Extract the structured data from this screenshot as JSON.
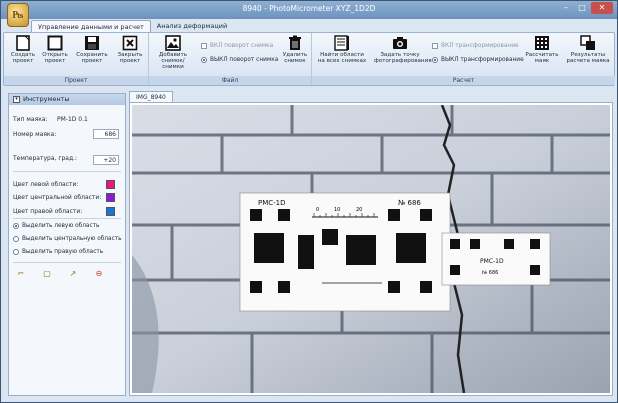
{
  "window": {
    "title": "8940 - PhotoMicrometer XYZ_1D2D",
    "logo_letter": "₧",
    "min": "–",
    "max": "□",
    "close": "✕"
  },
  "tabs": [
    {
      "label": "Управление данными и расчет",
      "active": true
    },
    {
      "label": "Анализ деформаций",
      "active": false
    }
  ],
  "ribbon": {
    "project": {
      "label": "Проект",
      "buttons": [
        {
          "label": "Создать проект",
          "icon": "new-project-icon"
        },
        {
          "label": "Открыть проект",
          "icon": "open-project-icon"
        },
        {
          "label": "Сохранить проект",
          "icon": "save-icon"
        },
        {
          "label": "Закрыть проект",
          "icon": "close-project-icon"
        }
      ]
    },
    "file": {
      "label": "Файл",
      "add_label": "Добавить снимок/снимки",
      "rot_on": "ВКЛ поворот снимка",
      "rot_off": "ВЫКЛ поворот снимка",
      "delete_label": "Удалить снимок"
    },
    "calc": {
      "label": "Расчет",
      "find_label": "Найти области на всех снимках",
      "point_label": "Задать точку фотографирования",
      "tr_on": "ВКЛ трансформирование",
      "tr_off": "ВЫКЛ трансформирование",
      "calc_label": "Рассчитать names",
      "results_label": "Результаты расчета names"
    }
  },
  "tools": {
    "header": "Инструменты",
    "type_label": "Тип names:",
    "type_value": "PM-1D 0.1",
    "number_label": "Номер names:",
    "number_value": "686",
    "temp_label": "Температура, град.:",
    "temp_value": "+20",
    "left_color_label": "Цвет левой области:",
    "center_color_label": "Цвет центральной области:",
    "right_color_label": "Цвет правой области:",
    "sel_left": "Выделить левую область",
    "sel_center": "Выделить центральную область",
    "sel_right": "Выделить правую область"
  },
  "colors": {
    "left": "#e6197a",
    "center": "#8a1ad6",
    "right": "#1a74d6"
  },
  "document": {
    "tab": "IMG_8940",
    "gauge_main_title": "PMC-1D",
    "gauge_main_number": "№ 686",
    "gauge_side_title": "PMC-1D",
    "gauge_side_number": "№ 686",
    "scale_0": "0",
    "scale_10": "10",
    "scale_20": "20"
  }
}
